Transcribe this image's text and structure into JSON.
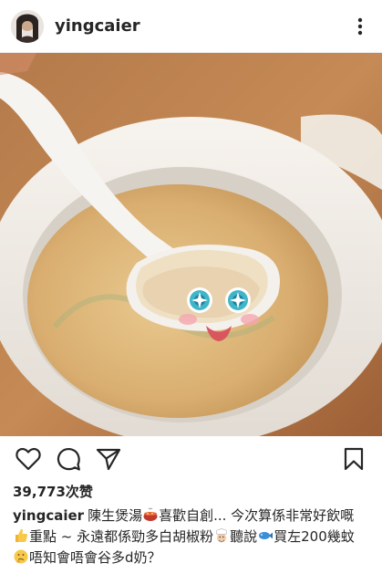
{
  "post": {
    "username": "yingcaier",
    "likes": "39,773次赞",
    "caption": {
      "part1": "陳生煲湯",
      "part2": "喜歡自創... 今次算係非常好飲嘅",
      "part3": "重點 ~ 永遠都係勁多白胡椒粉",
      "part4": "聽說",
      "part5": "買左200幾蚊",
      "part6": "唔知會唔會谷多d奶？"
    }
  },
  "icons": {
    "more": "more-vertical-icon",
    "like": "heart-icon",
    "comment": "comment-icon",
    "share": "send-icon",
    "save": "bookmark-icon"
  }
}
